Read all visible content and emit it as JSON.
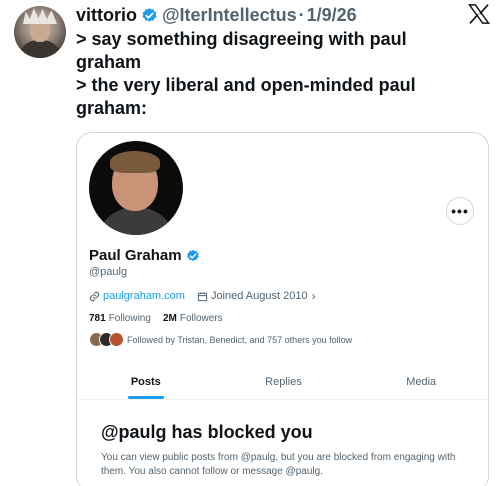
{
  "tweet": {
    "author_name": "vittorio",
    "author_handle": "@IterIntellectus",
    "separator": "·",
    "date": "1/9/26",
    "lines": [
      "> say something disagreeing with paul graham",
      "> the very liberal and open-minded paul graham:"
    ]
  },
  "profile": {
    "name": "Paul Graham",
    "handle": "@paulg",
    "more_label": "•••",
    "website": "paulgraham.com",
    "joined": "Joined August 2010",
    "chevron": "›",
    "following_count": "781",
    "following_label": "Following",
    "followers_count": "2M",
    "followers_label": "Followers",
    "followed_by": "Followed by Tristan, Benedict, and 757 others you follow",
    "tabs": [
      {
        "label": "Posts",
        "active": true
      },
      {
        "label": "Replies",
        "active": false
      },
      {
        "label": "Media",
        "active": false
      }
    ],
    "blocked_title": "@paulg has blocked you",
    "blocked_text": "You can view public posts from @paulg, but you are blocked from engaging with them. You also cannot follow or message @paulg."
  },
  "icons": {
    "verified": "verified-badge-icon",
    "brand": "x-logo-icon",
    "link": "link-icon",
    "calendar": "calendar-icon",
    "more": "more-icon"
  },
  "colors": {
    "accent": "#1d9bf0",
    "text": "#0f1419",
    "muted": "#536471",
    "border": "#cfd9de"
  }
}
